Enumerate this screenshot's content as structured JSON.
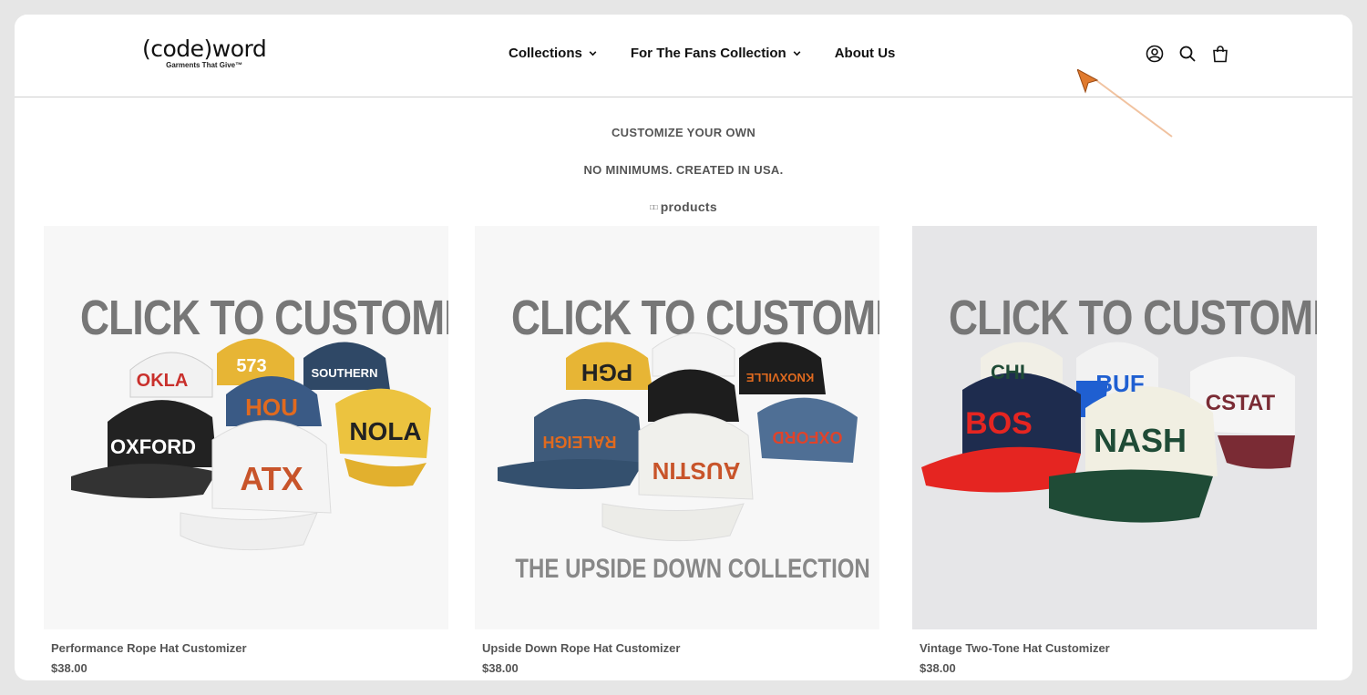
{
  "header": {
    "logo_main": "(code)word",
    "logo_sub": "Garments That Give™",
    "nav": [
      {
        "label": "Collections",
        "has_dropdown": true
      },
      {
        "label": "For The Fans Collection",
        "has_dropdown": true
      },
      {
        "label": "About Us",
        "has_dropdown": false
      }
    ],
    "icons": [
      "account-icon",
      "search-icon",
      "cart-icon"
    ]
  },
  "intro": {
    "line1": "CUSTOMIZE YOUR OWN",
    "line2": "NO MINIMUMS. CREATED IN USA.",
    "count_glyph": "□□",
    "count_label": "products"
  },
  "products": [
    {
      "name": "Performance Rope Hat Customizer",
      "price": "$38.00",
      "image_title": "CLICK TO CUSTOMIZE",
      "hat_texts": [
        "OKLA",
        "573",
        "SOUTHERN",
        "HOU",
        "OXFORD",
        "NOLA",
        "ATX"
      ]
    },
    {
      "name": "Upside Down Rope Hat Customizer",
      "price": "$38.00",
      "image_title": "CLICK TO CUSTOMIZE",
      "image_caption": "THE UPSIDE DOWN COLLECTION",
      "hat_texts": [
        "PGH",
        "KNOXVILLE",
        "RALEIGH",
        "OXFORD",
        "AUSTIN"
      ]
    },
    {
      "name": "Vintage Two-Tone Hat Customizer",
      "price": "$38.00",
      "image_title": "CLICK TO CUSTOMIZE",
      "hat_texts": [
        "CHI",
        "BUF",
        "CSTAT",
        "BOS",
        "NASH"
      ]
    }
  ],
  "colors": {
    "background": "#e6e6e6",
    "text": "#111111",
    "muted": "#555555",
    "cursor_accent": "#e07a2e"
  }
}
